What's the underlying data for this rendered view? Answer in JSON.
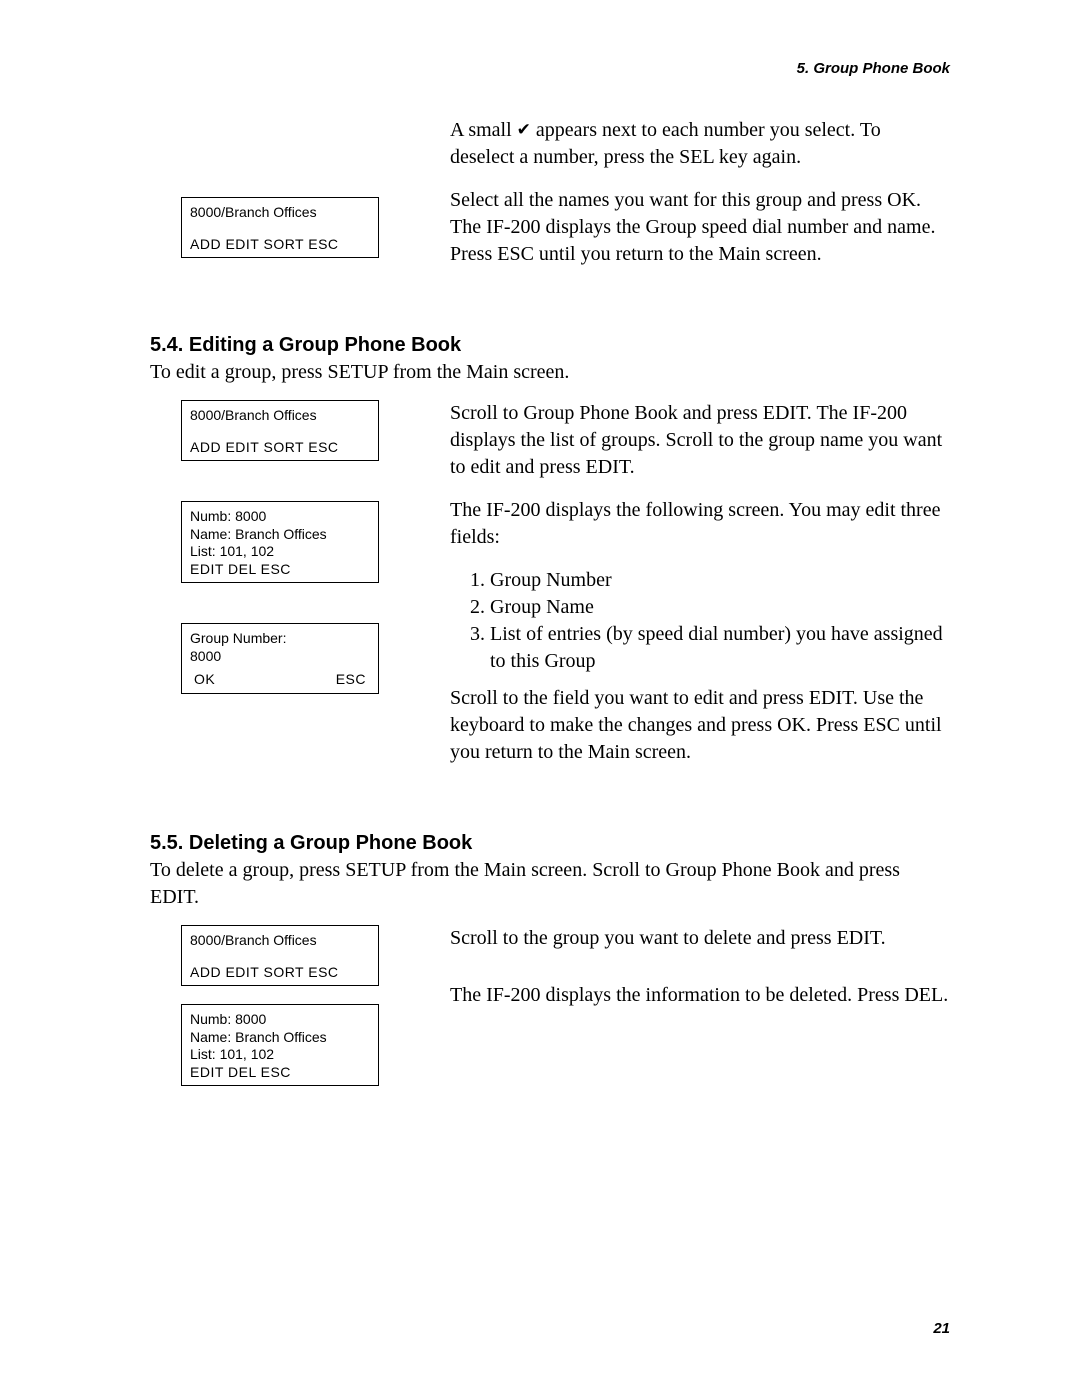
{
  "header": "5.  Group Phone Book",
  "intro": {
    "p1_pre": "A small ",
    "p1_post": " appears next to each number you select. To deselect a number, press the SEL key again.",
    "p2": "Select all the names you want for this group and press OK. The IF-200 displays the Group speed dial number and name. Press ESC until you return to the Main screen."
  },
  "lcd_group": {
    "line1": "8000/Branch Offices",
    "menu": "ADD   EDIT  SORT   ESC"
  },
  "sec54": {
    "title": "5.4.  Editing a Group Phone Book",
    "lead": "To edit a group, press SETUP from the Main screen.",
    "r1": "Scroll to Group Phone Book and press EDIT. The IF-200 displays the list of groups. Scroll to the group name you want to edit and press EDIT.",
    "r2": "The IF-200 displays the following screen. You may edit three fields:",
    "fields": [
      "Group Number",
      "Group Name",
      "List of entries (by speed dial number) you have assigned to this Group"
    ],
    "r3": "Scroll to the field you want to edit and press EDIT. Use the keyboard to make the changes and press OK. Press ESC until you return to the Main screen."
  },
  "lcd_detail": {
    "l1": "Numb:  8000",
    "l2": "Name:  Branch Offices",
    "l3": "List:      101, 102",
    "menu": "        EDIT  DEL    ESC"
  },
  "lcd_number": {
    "l1": "Group Number:",
    "l2": "8000",
    "menu_left": "OK",
    "menu_right": "ESC"
  },
  "sec55": {
    "title": "5.5.  Deleting a Group Phone Book",
    "lead": "To delete a group, press SETUP from the Main screen. Scroll to Group Phone Book and press EDIT.",
    "r1": "Scroll to the group you want to delete and press EDIT.",
    "r2": "The IF-200 displays the information to be deleted. Press DEL."
  },
  "page_number": "21"
}
